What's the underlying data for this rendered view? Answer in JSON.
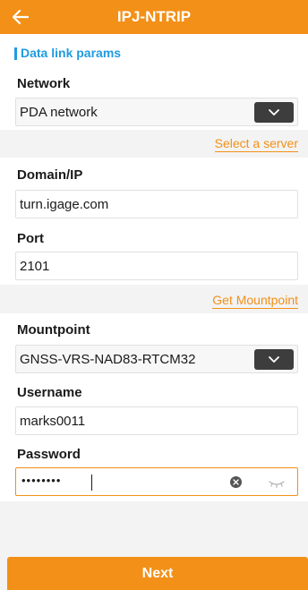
{
  "header": {
    "title": "IPJ-NTRIP"
  },
  "section": {
    "title": "Data link params"
  },
  "network": {
    "label": "Network",
    "value": "PDA network"
  },
  "select_server": {
    "label": "Select a server"
  },
  "domain": {
    "label": "Domain/IP",
    "value": "turn.igage.com"
  },
  "port": {
    "label": "Port",
    "value": "2101"
  },
  "get_mountpoint": {
    "label": "Get Mountpoint"
  },
  "mountpoint": {
    "label": "Mountpoint",
    "value": "GNSS-VRS-NAD83-RTCM32"
  },
  "username": {
    "label": "Username",
    "value": "marks0011"
  },
  "password": {
    "label": "Password",
    "masked": "••••••••"
  },
  "footer": {
    "next_label": "Next"
  },
  "colors": {
    "accent": "#f29018",
    "section_blue": "#1f9be0",
    "dropdown_btn": "#3d3d3d",
    "band_bg": "#f3f3f3"
  }
}
